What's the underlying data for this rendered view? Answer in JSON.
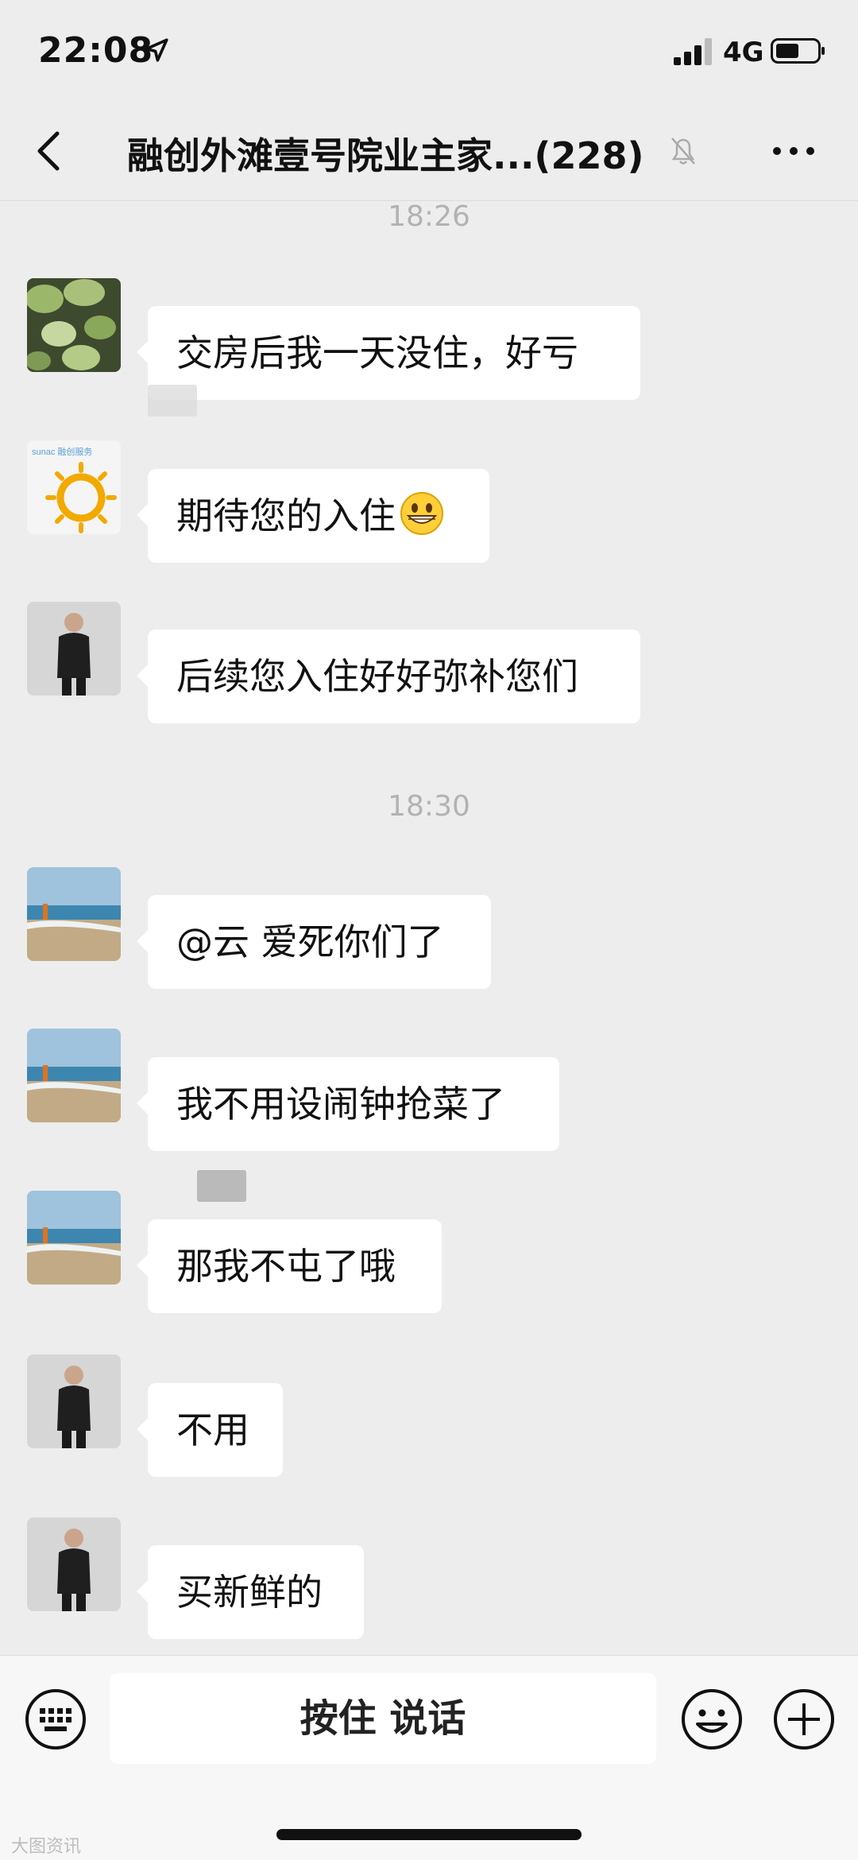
{
  "status_bar": {
    "time": "22:08",
    "network": "4G"
  },
  "header": {
    "title": "融创外滩壹号院业主家...(228)"
  },
  "timestamps": [
    "18:26",
    "18:30"
  ],
  "messages": [
    {
      "text": "交房后我一天没住，好亏"
    },
    {
      "text": "期待您的入住",
      "emoji": "grinning-face-emoji"
    },
    {
      "text": "后续您入住好好弥补您们"
    },
    {
      "text": "@云 爱死你们了"
    },
    {
      "text": "我不用设闹钟抢菜了"
    },
    {
      "text": "那我不屯了哦"
    },
    {
      "text": "不用"
    },
    {
      "text": "买新鲜的"
    }
  ],
  "avatars": {
    "sunac_logo_text": "sunac 融创服务"
  },
  "input_bar": {
    "voice_label": "按住 说话"
  },
  "watermark": "大图资讯",
  "colors": {
    "background": "#ededed",
    "bubble": "#ffffff",
    "timestamp": "#b2b2b2"
  }
}
